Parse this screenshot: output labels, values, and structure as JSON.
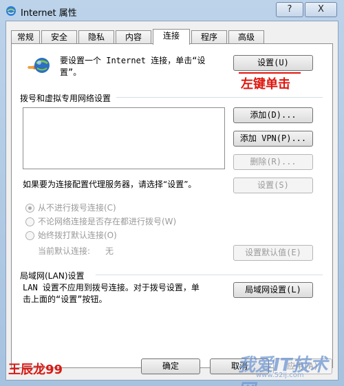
{
  "window": {
    "title": "Internet 属性",
    "help_label": "?",
    "close_label": "X"
  },
  "tabs": [
    {
      "label": "常规"
    },
    {
      "label": "安全"
    },
    {
      "label": "隐私"
    },
    {
      "label": "内容"
    },
    {
      "label": "连接",
      "active": true
    },
    {
      "label": "程序"
    },
    {
      "label": "高级"
    }
  ],
  "setup": {
    "text": "要设置一个 Internet 连接，单击“设置”。",
    "text_line1": "要设置一个 Internet 连接，单击“设",
    "text_line2": "置”。",
    "button": "设置(U)",
    "annotation": "左键单击"
  },
  "dialup": {
    "heading": "拨号和虚拟专用网络设置",
    "add_button": "添加(D)...",
    "add_vpn_button": "添加 VPN(P)...",
    "delete_button": "删除(R)...",
    "proxy_text": "如果要为连接配置代理服务器，请选择“设置”。",
    "settings_button": "设置(S)",
    "options": [
      {
        "label": "从不进行拨号连接(C)",
        "checked": true
      },
      {
        "label": "不论网络连接是否存在都进行拨号(W)",
        "checked": false
      },
      {
        "label": "始终拨打默认连接(O)",
        "checked": false
      }
    ],
    "current_default_label": "当前默认连接:",
    "current_default_value": "无",
    "set_default_button": "设置默认值(E)"
  },
  "lan": {
    "heading": "局域网(LAN)设置",
    "text_line1": "LAN 设置不应用到拨号连接。对于拨号设置，单",
    "text_line2": "击上面的“设置”按钮。",
    "button": "局域网设置(L)"
  },
  "footer": {
    "ok_button": "确定",
    "cancel_button": "取消",
    "apply_button": "应用(A)"
  },
  "watermarks": {
    "author": "王辰龙99",
    "site": "我爱IT技术网",
    "url": "www.52ij.com"
  },
  "colors": {
    "annotation_red": "#e0140c",
    "title_bar_blue": "#bcd3ea"
  }
}
